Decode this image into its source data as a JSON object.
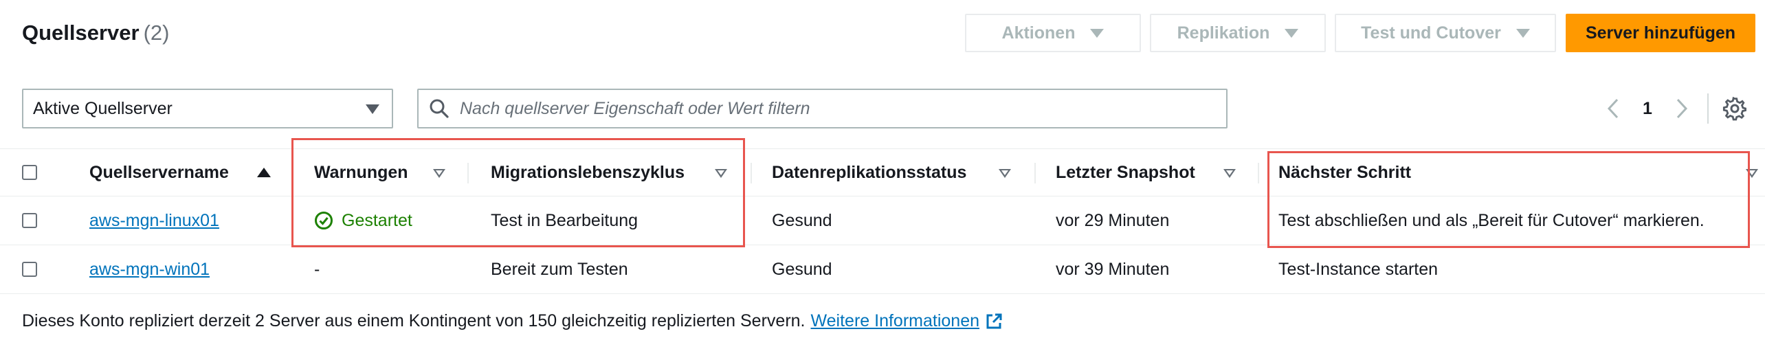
{
  "header": {
    "title": "Quellserver",
    "count": "(2)",
    "actions_label": "Aktionen",
    "replication_label": "Replikation",
    "test_cutover_label": "Test und Cutover",
    "add_server_label": "Server hinzufügen"
  },
  "filter": {
    "select_value": "Aktive Quellserver",
    "search_placeholder": "Nach quellserver Eigenschaft oder Wert filtern"
  },
  "pagination": {
    "current_page": "1"
  },
  "table": {
    "columns": [
      "Quellservername",
      "Warnungen",
      "Migrationslebenszyklus",
      "Datenreplikationsstatus",
      "Letzter Snapshot",
      "Nächster Schritt"
    ],
    "rows": [
      {
        "name": "aws-mgn-linux01",
        "warning": "Gestartet",
        "lifecycle": "Test in Bearbeitung",
        "replication": "Gesund",
        "snapshot": "vor 29 Minuten",
        "next_step": "Test abschließen und als „Bereit für Cutover“ markieren."
      },
      {
        "name": "aws-mgn-win01",
        "warning": "-",
        "lifecycle": "Bereit zum Testen",
        "replication": "Gesund",
        "snapshot": "vor 39 Minuten",
        "next_step": "Test-Instance starten"
      }
    ]
  },
  "footer": {
    "text": "Dieses Konto repliziert derzeit 2 Server aus einem Kontingent von 150 gleichzeitig replizierten Servern.",
    "link": "Weitere Informationen"
  },
  "colors": {
    "primary_button": "#ff9900",
    "link": "#0073bb",
    "success": "#1d8102",
    "highlight": "#e8554e",
    "disabled_text": "#aab7b8"
  },
  "icons": {
    "search": "search-icon",
    "settings": "gear-icon",
    "status_ok": "check-circle-icon",
    "external": "external-link-icon"
  }
}
